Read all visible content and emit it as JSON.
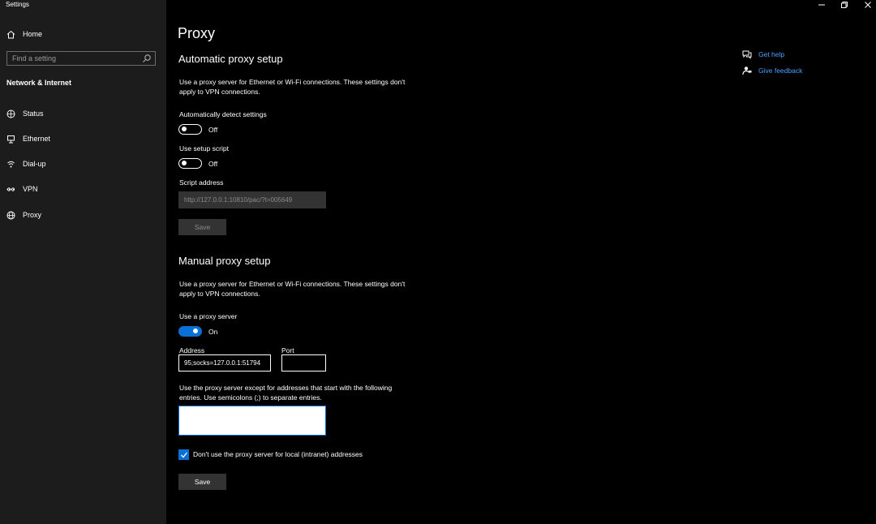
{
  "window": {
    "title": "Settings",
    "controls": {
      "minimize": "—",
      "restore": "⧉",
      "close": "✕"
    }
  },
  "sidebar": {
    "home_label": "Home",
    "search_placeholder": "Find a setting",
    "section_title": "Network & Internet",
    "items": [
      {
        "label": "Status",
        "icon": "globe-status-icon"
      },
      {
        "label": "Ethernet",
        "icon": "ethernet-icon"
      },
      {
        "label": "Dial-up",
        "icon": "dialup-icon"
      },
      {
        "label": "VPN",
        "icon": "vpn-icon"
      },
      {
        "label": "Proxy",
        "icon": "globe-icon"
      }
    ]
  },
  "main": {
    "title": "Proxy",
    "automatic": {
      "heading": "Automatic proxy setup",
      "description": "Use a proxy server for Ethernet or Wi-Fi connections. These settings don't apply to VPN connections.",
      "auto_detect": {
        "label": "Automatically detect settings",
        "state": "Off",
        "on": false
      },
      "setup_script": {
        "label": "Use setup script",
        "state": "Off",
        "on": false
      },
      "script_address": {
        "label": "Script address",
        "value": "http://127.0.0.1:10810/pac/?t=005649"
      },
      "save_label": "Save"
    },
    "manual": {
      "heading": "Manual proxy setup",
      "description": "Use a proxy server for Ethernet or Wi-Fi connections. These settings don't apply to VPN connections.",
      "use_proxy": {
        "label": "Use a proxy server",
        "state": "On",
        "on": true
      },
      "address": {
        "label": "Address",
        "value": "95;socks=127.0.0.1:51794"
      },
      "port": {
        "label": "Port",
        "value": ""
      },
      "exceptions": {
        "description": "Use the proxy server except for addresses that start with the following entries. Use semicolons (;) to separate entries.",
        "value": ""
      },
      "local_bypass": {
        "label": "Don't use the proxy server for local (intranet) addresses",
        "checked": true
      },
      "save_label": "Save"
    }
  },
  "help": {
    "get_help": "Get help",
    "give_feedback": "Give feedback"
  },
  "colors": {
    "accent": "#0a6fd6",
    "sidebar_bg": "#1c1c1c",
    "main_bg": "#000000",
    "link": "#4aa0ff"
  }
}
